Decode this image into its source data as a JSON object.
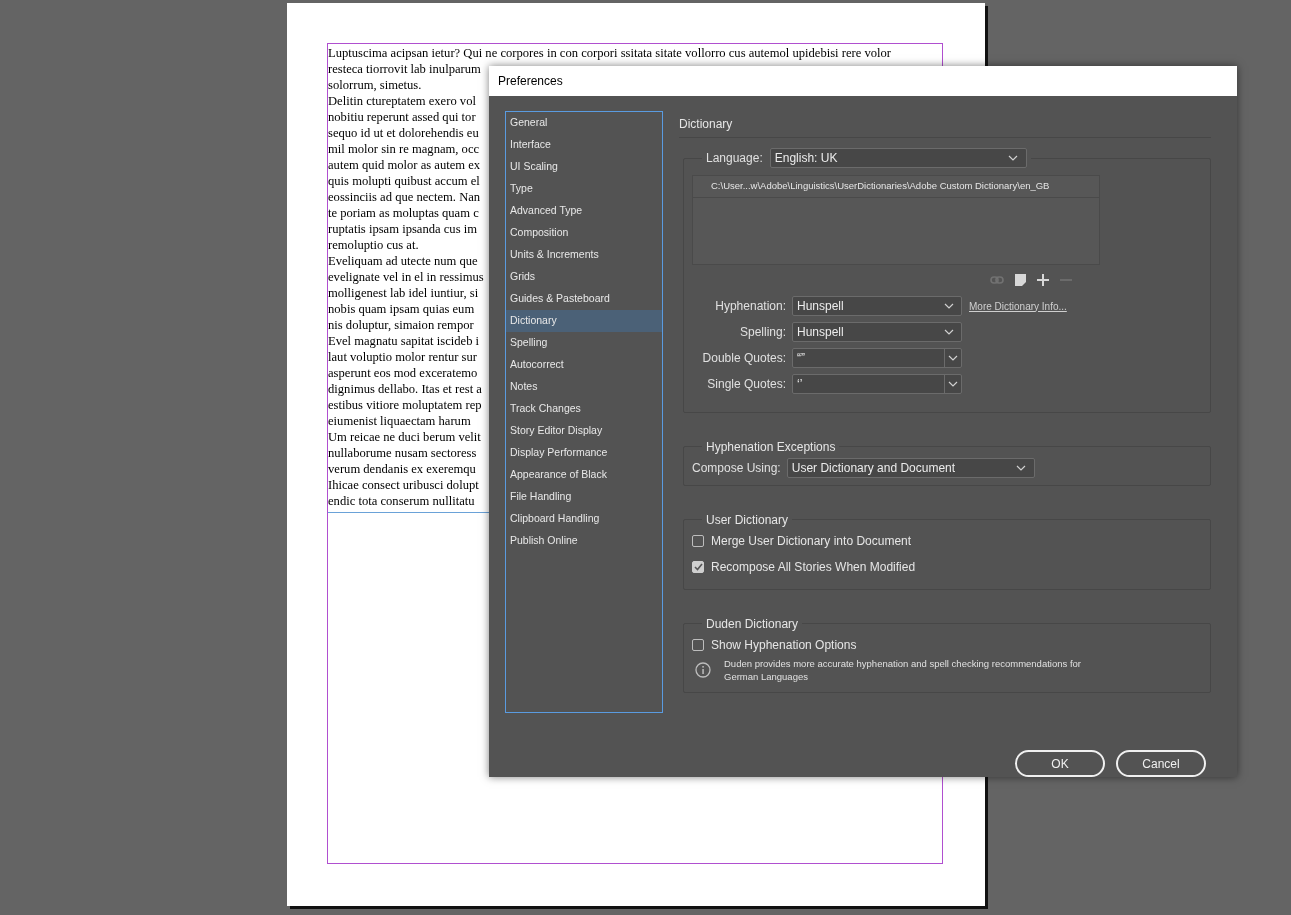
{
  "document": {
    "lines": [
      "Luptuscima acipsan ietur? Qui ne corpores in con corpori ssitata sitate vollorro cus autemol upidebisi rere volor",
      "resteca tiorrovit lab inulparum",
      "solorrum, simetus.",
      "Delitin ctureptatem exero vol",
      "nobitiu reperunt assed qui tor",
      "sequo id ut et dolorehendis eu",
      "mil molor sin re magnam, occ",
      "autem quid molor as autem ex",
      "quis molupti quibust accum el",
      "eossinciis ad que nectem. Nan",
      "te poriam as moluptas quam c",
      "ruptatis ipsam ipsanda cus im",
      "remoluptio cus at.",
      "Eveliquam ad utecte num que",
      "evelignate vel in el in ressimus",
      "molligenest lab idel iuntiur, si",
      "nobis quam ipsam quias eum",
      "nis doluptur, simaion rempor",
      "Evel magnatu sapitat iscideb i",
      "laut voluptio molor rentur sur",
      "asperunt eos mod exceratemo",
      "dignimus dellabo. Itas et rest a",
      "estibus vitiore moluptatem rep",
      "eiumenist liquaectam harum",
      "Um reicae ne duci berum velit",
      "nullaborume nusam sectoress",
      "verum dendanis ex exeremqu",
      "Ihicae consect uribusci dolupt",
      "endic tota conserum nullitatu"
    ]
  },
  "dialog": {
    "title": "Preferences",
    "sidebar": {
      "items": [
        {
          "label": "General",
          "selected": false
        },
        {
          "label": "Interface",
          "selected": false
        },
        {
          "label": "UI Scaling",
          "selected": false
        },
        {
          "label": "Type",
          "selected": false
        },
        {
          "label": "Advanced Type",
          "selected": false
        },
        {
          "label": "Composition",
          "selected": false
        },
        {
          "label": "Units & Increments",
          "selected": false
        },
        {
          "label": "Grids",
          "selected": false
        },
        {
          "label": "Guides & Pasteboard",
          "selected": false
        },
        {
          "label": "Dictionary",
          "selected": true
        },
        {
          "label": "Spelling",
          "selected": false
        },
        {
          "label": "Autocorrect",
          "selected": false
        },
        {
          "label": "Notes",
          "selected": false
        },
        {
          "label": "Track Changes",
          "selected": false
        },
        {
          "label": "Story Editor Display",
          "selected": false
        },
        {
          "label": "Display Performance",
          "selected": false
        },
        {
          "label": "Appearance of Black",
          "selected": false
        },
        {
          "label": "File Handling",
          "selected": false
        },
        {
          "label": "Clipboard Handling",
          "selected": false
        },
        {
          "label": "Publish Online",
          "selected": false
        }
      ]
    },
    "panel_title": "Dictionary",
    "language": {
      "label": "Language:",
      "value": "English: UK"
    },
    "dictionary_list": {
      "rows": [
        "C:\\User...w\\Adobe\\Linguistics\\UserDictionaries\\Adobe Custom Dictionary\\en_GB"
      ]
    },
    "list_tools": [
      {
        "kind": "link",
        "disabled": true
      },
      {
        "kind": "page",
        "disabled": false
      },
      {
        "kind": "add",
        "disabled": false
      },
      {
        "kind": "remove",
        "disabled": true
      }
    ],
    "fields": [
      {
        "kind": "select",
        "label": "Hyphenation:",
        "value": "Hunspell"
      },
      {
        "kind": "select",
        "label": "Spelling:",
        "value": "Hunspell"
      },
      {
        "kind": "combo",
        "label": "Double Quotes:",
        "value": "“”"
      },
      {
        "kind": "combo",
        "label": "Single Quotes:",
        "value": "‘’"
      }
    ],
    "more_link": "More Dictionary Info...",
    "hyphenation_exceptions": {
      "title": "Hyphenation Exceptions",
      "label": "Compose Using:",
      "value": "User Dictionary and Document"
    },
    "user_dictionary": {
      "title": "User Dictionary",
      "options": [
        {
          "label": "Merge User Dictionary into Document",
          "checked": false
        },
        {
          "label": "Recompose All Stories When Modified",
          "checked": true
        }
      ]
    },
    "duden": {
      "title": "Duden Dictionary",
      "options": [
        {
          "label": "Show Hyphenation Options",
          "checked": false
        }
      ],
      "note": "Duden provides more accurate hyphenation and spell checking recommendations for German Languages"
    },
    "buttons": [
      "OK",
      "Cancel"
    ]
  }
}
